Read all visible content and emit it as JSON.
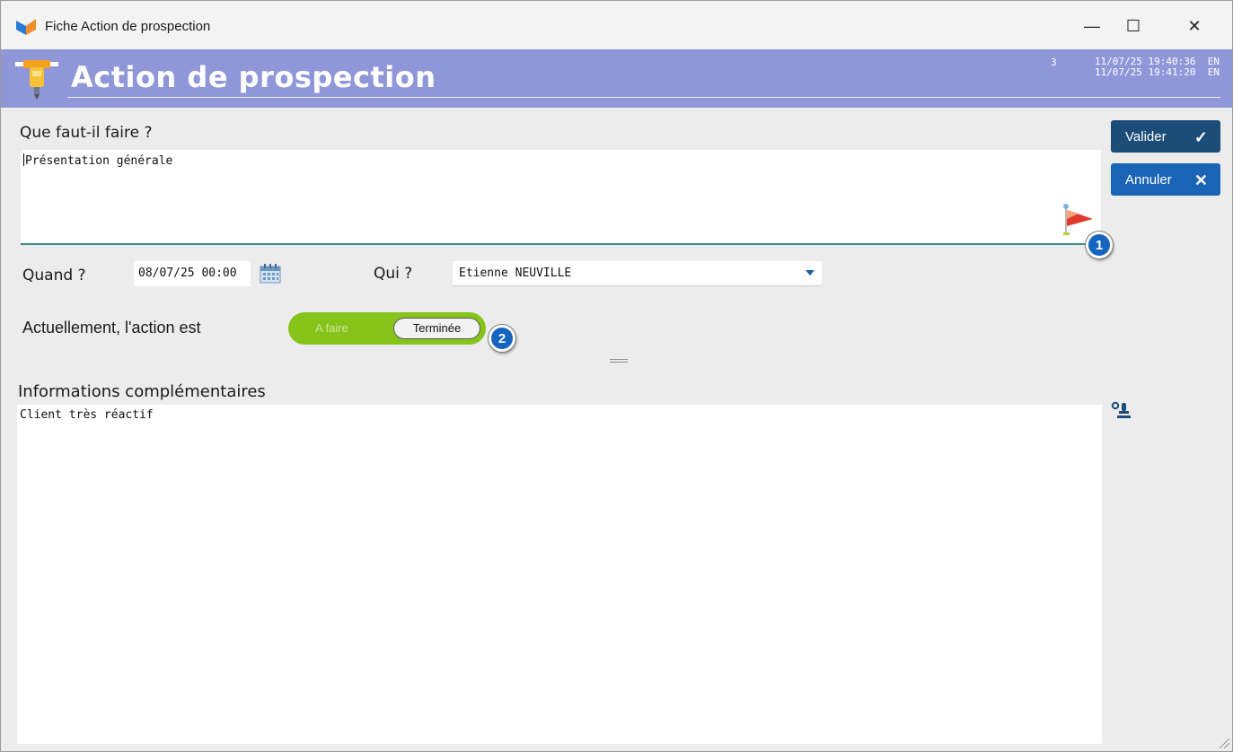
{
  "window": {
    "title": "Fiche Action de prospection",
    "minimize": "—",
    "maximize": "☐",
    "close": "✕"
  },
  "header": {
    "title": "Action de prospection",
    "record_number": "3",
    "created": "11/07/25 19:40:36  EN",
    "modified": "11/07/25 19:41:20  EN",
    "band_color": "#8f97d9"
  },
  "task": {
    "label": "Que faut-il faire ?",
    "value": "Présentation générale"
  },
  "when": {
    "label": "Quand ?",
    "value": "08/07/25 00:00"
  },
  "who": {
    "label": "Qui ?",
    "value": "Etienne NEUVILLE"
  },
  "status": {
    "label": "Actuellement, l'action est",
    "option_todo": "A faire",
    "option_done": "Terminée",
    "selected": "Terminée",
    "toggle_color": "#86c31b"
  },
  "info": {
    "label": "Informations complémentaires",
    "value": "Client très réactif"
  },
  "buttons": {
    "validate": "Valider",
    "cancel": "Annuler"
  },
  "badges": {
    "one": "1",
    "two": "2"
  }
}
